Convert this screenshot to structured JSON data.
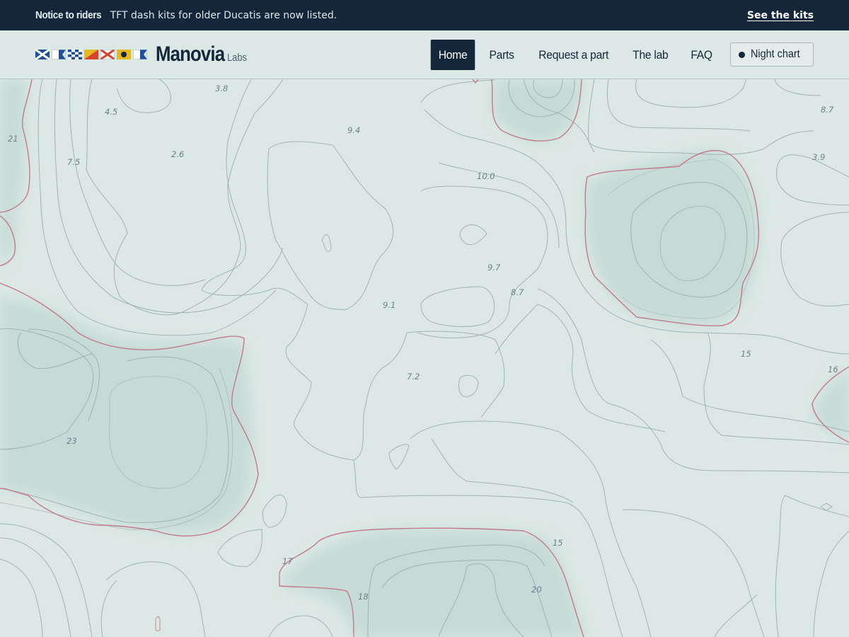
{
  "notice": {
    "tag": "Notice to riders",
    "message": "TFT dash kits for older Ducatis are now listed.",
    "cta": "See the kits"
  },
  "brand": {
    "name": "Manovia",
    "sub": "Labs",
    "flag_icons": [
      "signal-flag-m-icon",
      "signal-flag-a-icon",
      "signal-flag-n-icon",
      "signal-flag-o-icon",
      "signal-flag-v-icon",
      "signal-flag-i-icon",
      "signal-flag-a-icon"
    ]
  },
  "nav": {
    "items": [
      {
        "label": "Home",
        "active": true
      },
      {
        "label": "Parts"
      },
      {
        "label": "Request a part"
      },
      {
        "label": "The lab"
      },
      {
        "label": "FAQ"
      }
    ],
    "toggle": {
      "label": "Night chart",
      "icon": "dot-icon"
    }
  },
  "chart": {
    "depth_labels": [
      "3.8",
      "4.5",
      "21",
      "2.6",
      "7.5",
      "9.4",
      "10.0",
      "8.7",
      "3.9",
      "9.7",
      "8.7",
      "9.1",
      "15",
      "16",
      "7.2",
      "23",
      "15",
      "17",
      "20",
      "18"
    ]
  },
  "colors": {
    "navy": "#14263a",
    "sea": "#dce8e5",
    "shoal": "#c8ddd9",
    "contour": "#9aa9ab",
    "danger_contour": "#c27b8c"
  }
}
